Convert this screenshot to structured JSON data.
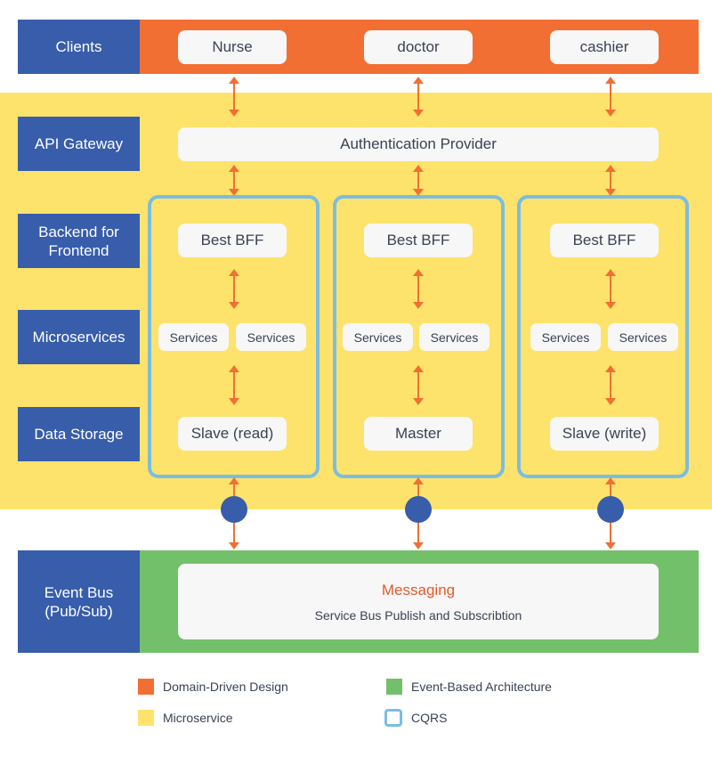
{
  "layers": {
    "clients": "Clients",
    "api_gateway": "API Gateway",
    "bff": "Backend for Frontend",
    "microservices": "Microservices",
    "data_storage": "Data Storage",
    "event_bus": "Event Bus (Pub/Sub)"
  },
  "clients": [
    "Nurse",
    "doctor",
    "cashier"
  ],
  "gateway": {
    "provider": "Authentication Provider"
  },
  "columns": [
    {
      "bff": "Best BFF",
      "services": [
        "Services",
        "Services"
      ],
      "storage": "Slave (read)"
    },
    {
      "bff": "Best BFF",
      "services": [
        "Services",
        "Services"
      ],
      "storage": "Master"
    },
    {
      "bff": "Best BFF",
      "services": [
        "Services",
        "Services"
      ],
      "storage": "Slave (write)"
    }
  ],
  "messaging": {
    "title": "Messaging",
    "subtitle": "Service Bus Publish and Subscribtion"
  },
  "legend": [
    {
      "label": "Domain-Driven Design",
      "color": "#f26f33",
      "style": "fill"
    },
    {
      "label": "Event-Based Architecture",
      "color": "#73c06a",
      "style": "fill"
    },
    {
      "label": "Microservice",
      "color": "#fde36b",
      "style": "fill"
    },
    {
      "label": "CQRS",
      "color": "#7abde2",
      "style": "outline"
    }
  ],
  "colors": {
    "ddd": "#f26f33",
    "microservice": "#fde36b",
    "event": "#73c06a",
    "cqrs": "#7abde2",
    "layer_label": "#375dab",
    "arrow": "#f26f33"
  }
}
